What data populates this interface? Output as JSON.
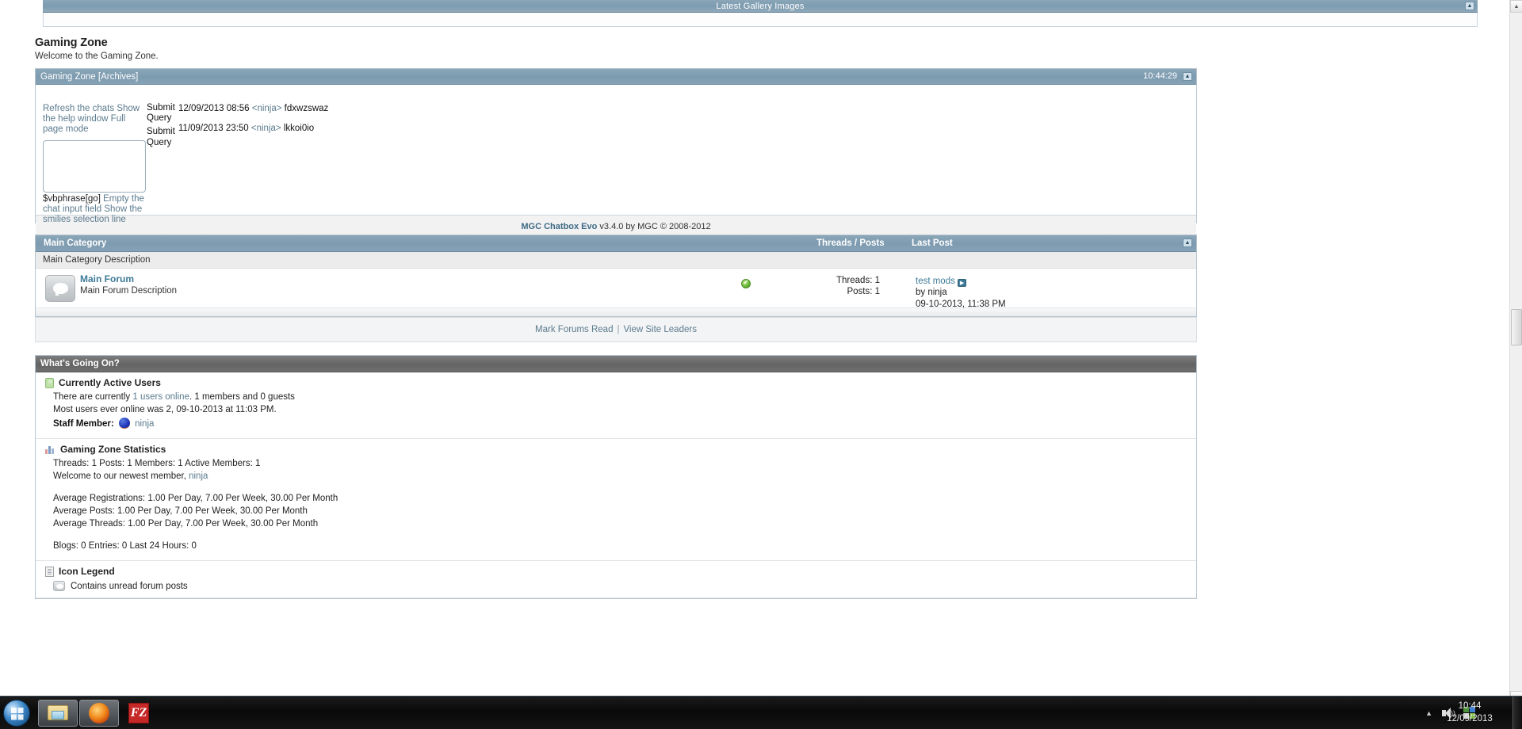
{
  "gallery": {
    "title": "Latest Gallery Images",
    "collapse_icon": "collapse-up-icon"
  },
  "page_head": {
    "title": "Gaming Zone",
    "subtitle": "Welcome to the Gaming Zone."
  },
  "chatbox": {
    "header_title": "Gaming Zone  [Archives]",
    "header_time": "10:44:29",
    "links_text": "Refresh the chats Show the help window Full page mode",
    "submit_1": "Submit Query",
    "submit_2": "Submit Query",
    "input_value": "",
    "go_label": "$vbphrase[go]",
    "sub_links_text": "Empty the chat input field Show the smilies selection line",
    "messages": [
      {
        "date": "12/09/2013 08:56",
        "nick": "<ninja>",
        "text": "fdxwzswaz"
      },
      {
        "date": "11/09/2013 23:50",
        "nick": "<ninja>",
        "text": "lkkoi0io"
      }
    ],
    "footer_name": "MGC Chatbox Evo",
    "footer_rest": "v3.4.0 by MGC © 2008-2012"
  },
  "forum": {
    "category_title": "Main Category",
    "col_threads_posts": "Threads / Posts",
    "col_last_post": "Last Post",
    "category_description": "Main Category Description",
    "rows": [
      {
        "title": "Main Forum",
        "description": "Main Forum Description",
        "threads": "Threads: 1",
        "posts": "Posts: 1",
        "last_post_title": "test mods",
        "last_post_by": "by ninja",
        "last_post_date": "09-10-2013, 11:38 PM"
      }
    ]
  },
  "mark_forums": {
    "mark_read": "Mark Forums Read",
    "separator": "|",
    "site_leaders": "View Site Leaders"
  },
  "whats_going_on": {
    "header": "What's Going On?",
    "active_users": {
      "title": "Currently Active Users",
      "line1_pre": "There are currently ",
      "line1_link": "1 users online",
      "line1_post": ". 1 members and 0 guests",
      "line2": "Most users ever online was 2, 09-10-2013 at 11:03 PM.",
      "staff_label": "Staff Member:",
      "staff_name": "ninja"
    },
    "statistics": {
      "title": "Gaming Zone Statistics",
      "counts": "Threads: 1  Posts: 1  Members: 1  Active Members: 1",
      "welcome_pre": "Welcome to our newest member, ",
      "welcome_member": "ninja",
      "avg_registrations": "Average Registrations: 1.00 Per Day, 7.00 Per Week, 30.00 Per Month",
      "avg_posts": "Average Posts: 1.00 Per Day, 7.00 Per Week, 30.00 Per Month",
      "avg_threads": "Average Threads: 1.00 Per Day, 7.00 Per Week, 30.00 Per Month",
      "blogs_line": "Blogs: 0  Entries: 0  Last 24 Hours: 0"
    },
    "icon_legend": {
      "title": "Icon Legend",
      "items": [
        {
          "label": "Contains unread forum posts"
        }
      ]
    }
  },
  "taskbar": {
    "start_label": "start-orb",
    "items": [
      {
        "name": "file-explorer",
        "label": "Windows Explorer"
      },
      {
        "name": "firefox",
        "label": "Mozilla Firefox"
      },
      {
        "name": "filezilla",
        "label": "FileZilla"
      }
    ],
    "tray": {
      "show_hidden": "▲",
      "volume": "speaker-icon",
      "action_center": "shield-icon"
    },
    "clock_time": "10:44",
    "clock_date": "12/09/2013"
  },
  "scrollbar": {
    "up_arrow": "▲",
    "down_arrow": "▼"
  },
  "colors": {
    "header_blue": "#7d9bb0",
    "header_gray": "#646464",
    "link_blue": "#5b7b8e",
    "forum_link": "#3d7a96",
    "status_green": "#6fbd3a"
  }
}
